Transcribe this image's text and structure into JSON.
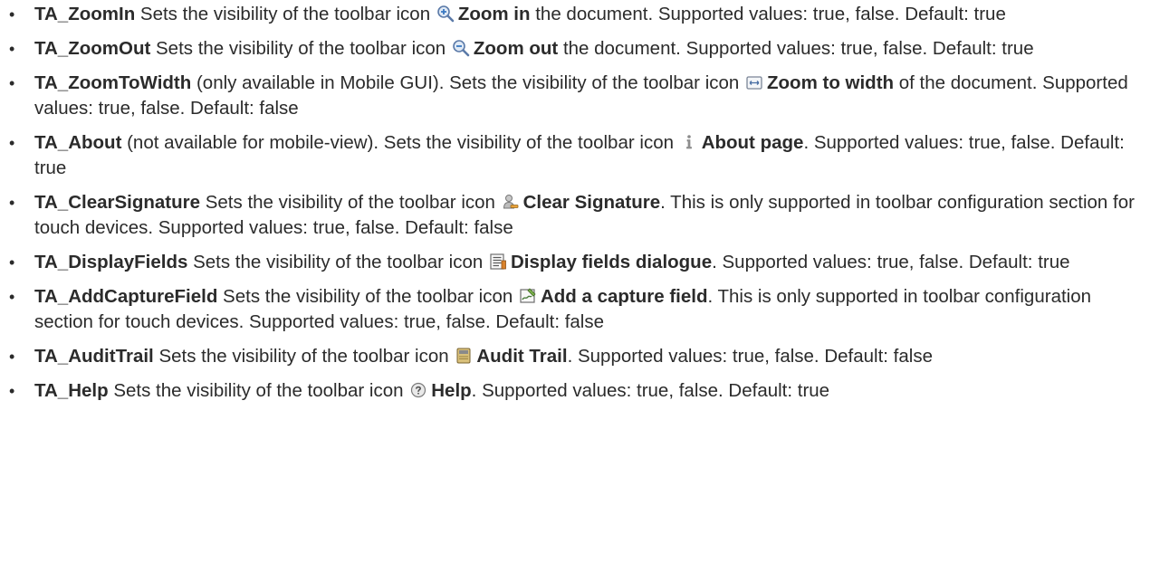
{
  "items": [
    {
      "name": "TA_ZoomIn",
      "pre": " Sets the visibility of the toolbar icon ",
      "icon": "zoom-in-icon",
      "action": "Zoom in",
      "post": " the document. Supported values: true, false. Default: true"
    },
    {
      "name": "TA_ZoomOut",
      "pre": " Sets the visibility of the toolbar icon ",
      "icon": "zoom-out-icon",
      "action": "Zoom out",
      "post": " the document. Supported values: true, false. Default: true"
    },
    {
      "name": "TA_ZoomToWidth",
      "pre": " (only available in Mobile GUI). Sets the visibility of the toolbar icon ",
      "icon": "zoom-to-width-icon",
      "action": "Zoom to width",
      "post": " of the document. Supported values: true, false. Default: false"
    },
    {
      "name": "TA_About",
      "pre": " (not available for mobile-view). Sets the visibility of the toolbar icon ",
      "icon": "about-icon",
      "action": "About page",
      "post": ". Supported values: true, false. Default: true"
    },
    {
      "name": "TA_ClearSignature",
      "pre": " Sets the visibility of the toolbar icon ",
      "icon": "clear-signature-icon",
      "action": "Clear Signature",
      "post": ". This is only supported in toolbar configuration section for touch devices. Supported values: true, false. Default: false"
    },
    {
      "name": "TA_DisplayFields",
      "pre": " Sets the visibility of the toolbar icon ",
      "icon": "display-fields-icon",
      "action": "Display fields dialogue",
      "post": ". Supported values: true, false. Default: true"
    },
    {
      "name": "TA_AddCaptureField",
      "pre": " Sets the visibility of the toolbar icon ",
      "icon": "add-capture-field-icon",
      "action": "Add a capture field",
      "post": ". This is only supported in toolbar configuration section for touch devices. Supported values: true, false. Default: false"
    },
    {
      "name": "TA_AuditTrail",
      "pre": " Sets the visibility of the toolbar icon ",
      "icon": "audit-trail-icon",
      "action": "Audit Trail",
      "post": ". Supported values: true, false. Default: false"
    },
    {
      "name": "TA_Help",
      "pre": " Sets the visibility of the toolbar icon ",
      "icon": "help-icon",
      "action": "Help",
      "post": ". Supported values: true, false. Default: true"
    }
  ]
}
